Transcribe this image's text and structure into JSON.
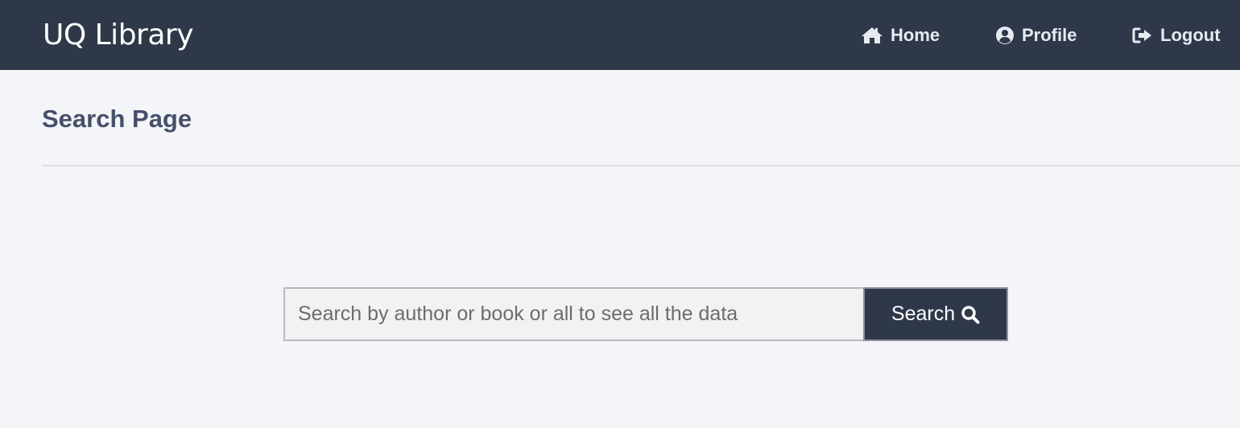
{
  "navbar": {
    "brand": "UQ Library",
    "links": [
      {
        "label": "Home",
        "icon": "home-icon"
      },
      {
        "label": "Profile",
        "icon": "user-circle-icon"
      },
      {
        "label": "Logout",
        "icon": "sign-out-icon"
      }
    ],
    "background_color": "#2f3849"
  },
  "main": {
    "title": "Search Page",
    "search": {
      "placeholder": "Search by author or book or all to see all the data",
      "value": "",
      "button_label": "Search",
      "button_icon": "search-icon"
    }
  }
}
